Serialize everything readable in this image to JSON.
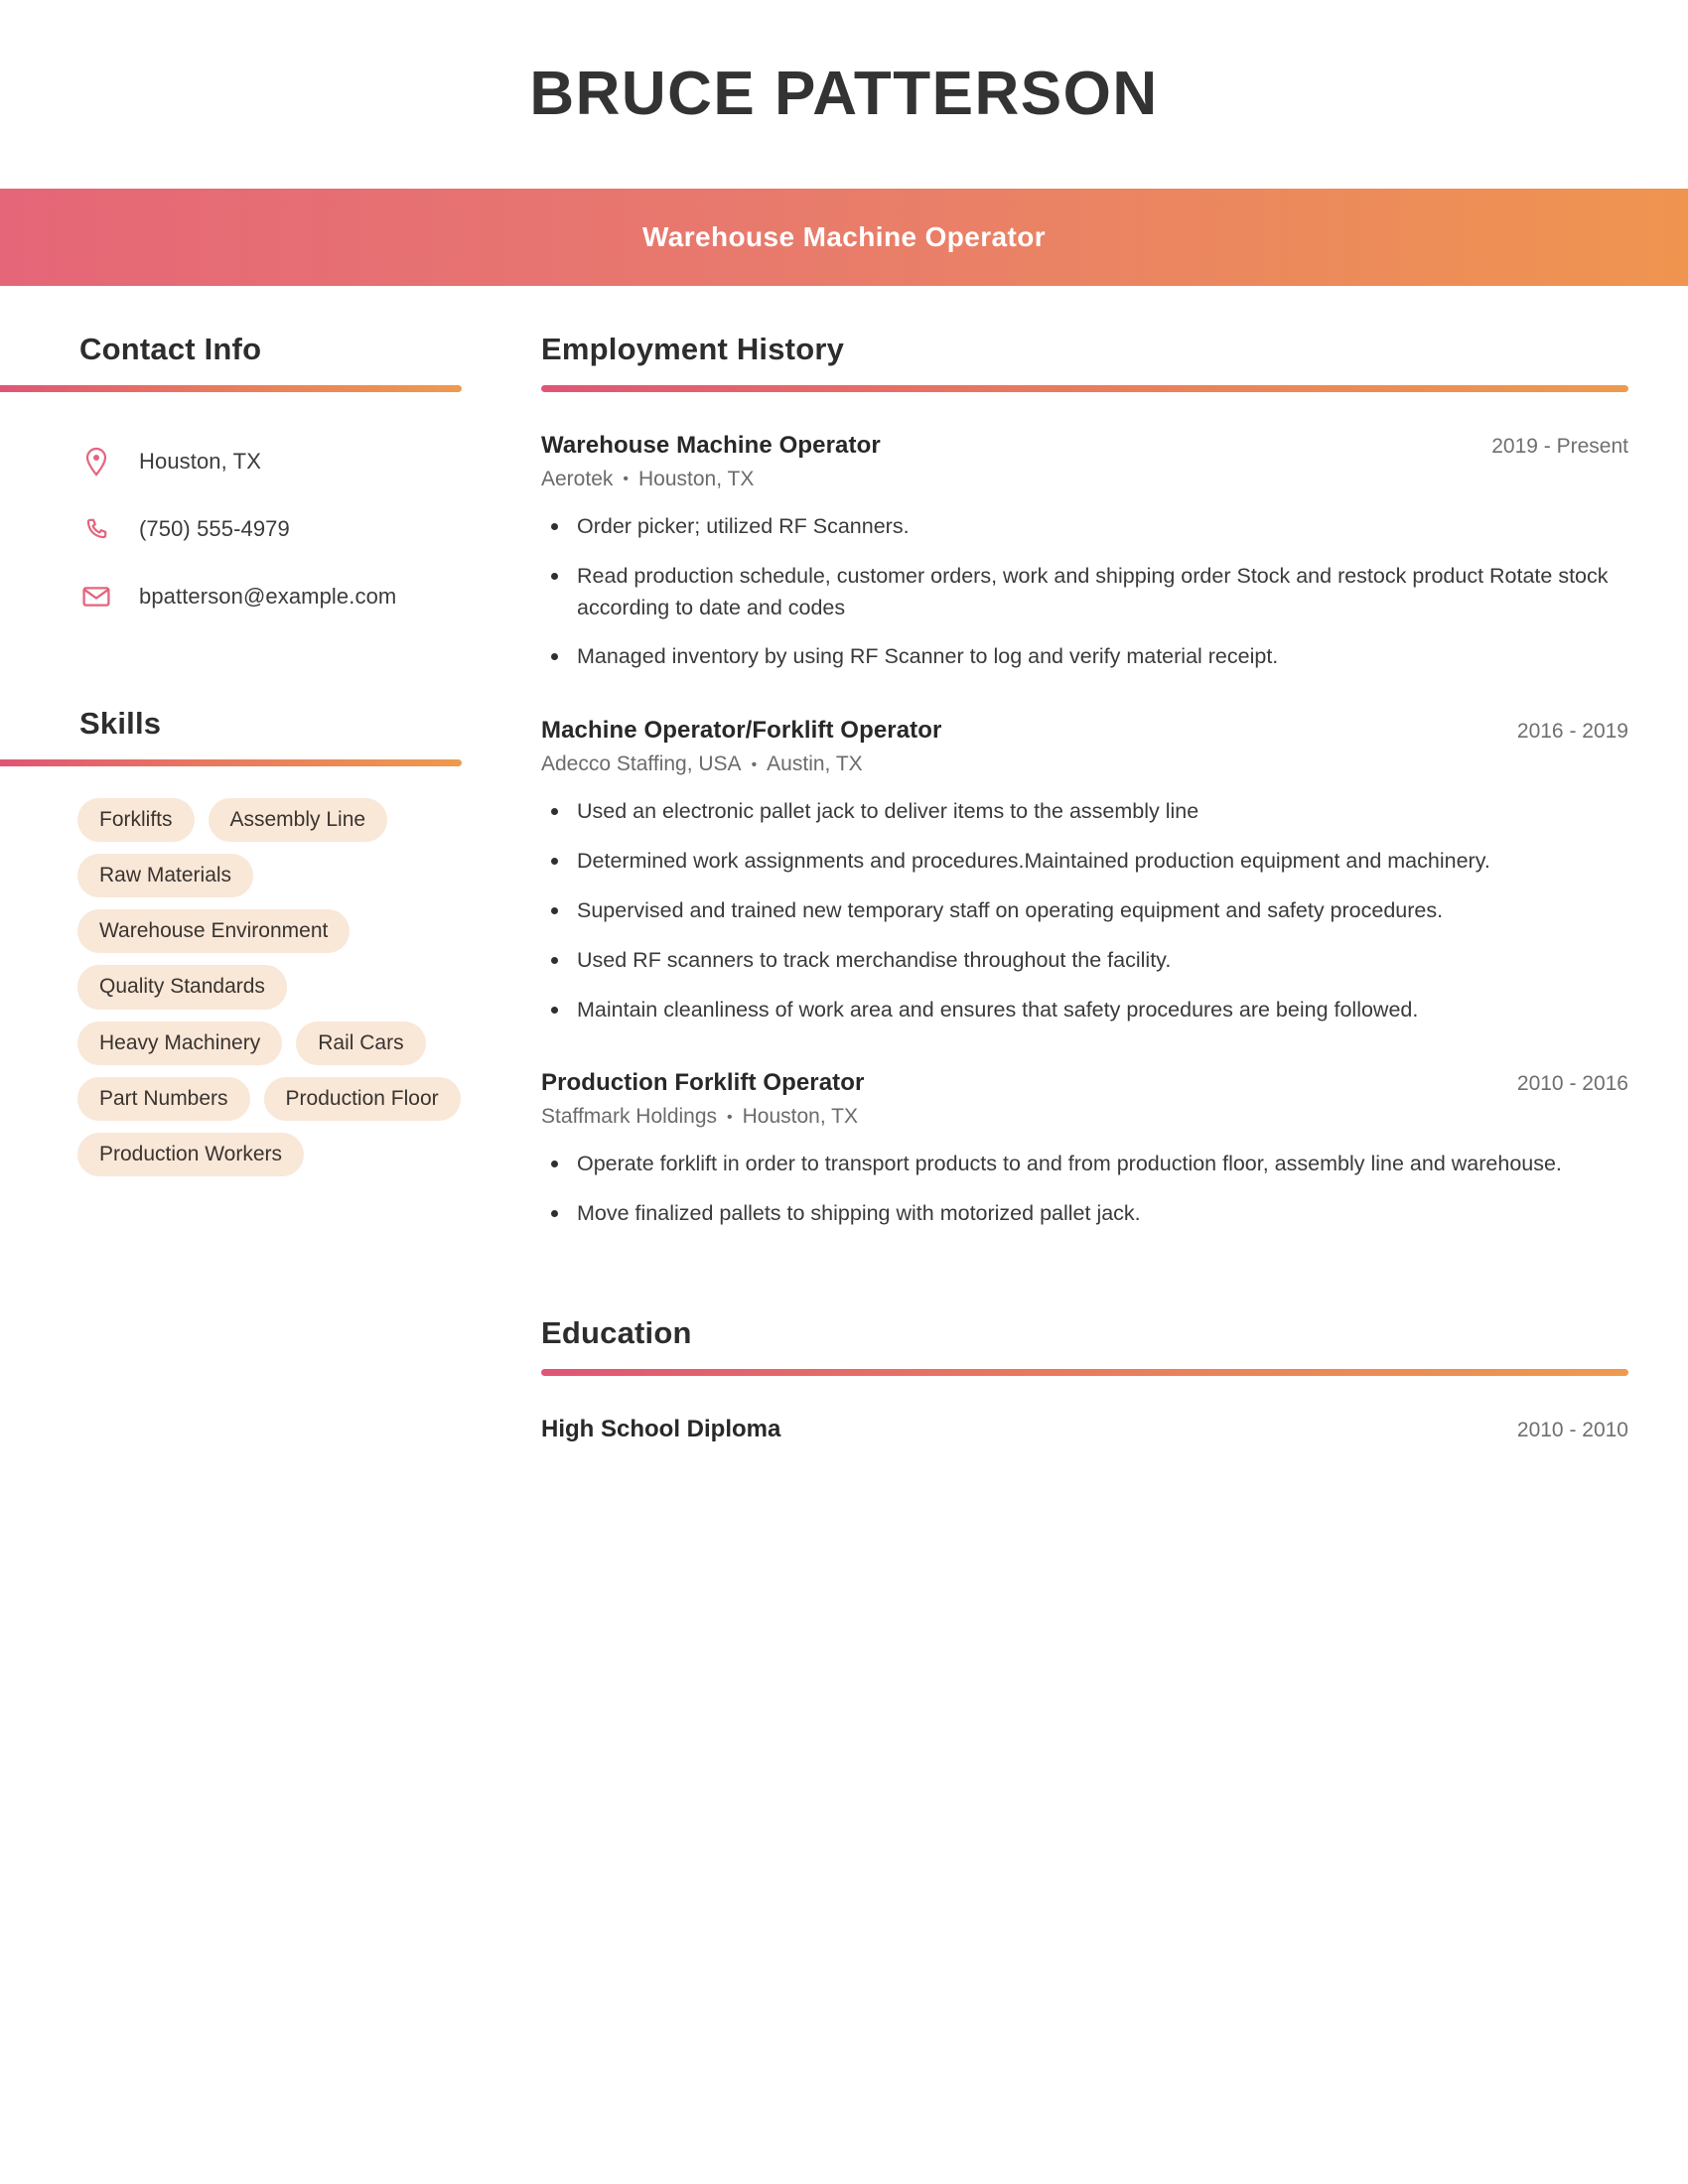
{
  "header": {
    "name": "BRUCE PATTERSON",
    "job_title": "Warehouse Machine Operator"
  },
  "sidebar": {
    "contact": {
      "heading": "Contact Info",
      "items": [
        {
          "icon": "location-pin-icon",
          "value": "Houston, TX"
        },
        {
          "icon": "phone-icon",
          "value": "(750) 555-4979"
        },
        {
          "icon": "envelope-icon",
          "value": "bpatterson@example.com"
        }
      ]
    },
    "skills": {
      "heading": "Skills",
      "items": [
        "Forklifts",
        "Assembly Line",
        "Raw Materials",
        "Warehouse Environment",
        "Quality Standards",
        "Heavy Machinery",
        "Rail Cars",
        "Part Numbers",
        "Production Floor",
        "Production Workers"
      ]
    }
  },
  "main": {
    "employment": {
      "heading": "Employment History",
      "jobs": [
        {
          "title": "Warehouse Machine Operator",
          "dates": "2019 - Present",
          "company": "Aerotek",
          "location": "Houston, TX",
          "bullets": [
            "Order picker; utilized RF Scanners.",
            "Read production schedule, customer orders, work and shipping order Stock and restock product Rotate stock according to date and codes",
            "Managed inventory by using RF Scanner to log and verify material receipt."
          ]
        },
        {
          "title": "Machine Operator/Forklift Operator",
          "dates": "2016 - 2019",
          "company": "Adecco Staffing, USA",
          "location": "Austin, TX",
          "bullets": [
            "Used an electronic pallet jack to deliver items to the assembly line",
            "Determined work assignments and procedures.Maintained production equipment and machinery.",
            "Supervised and trained new temporary staff on operating equipment and safety procedures.",
            "Used RF scanners to track merchandise throughout the facility.",
            "Maintain cleanliness of work area and ensures that safety procedures are being followed."
          ]
        },
        {
          "title": "Production Forklift Operator",
          "dates": "2010 - 2016",
          "company": "Staffmark Holdings",
          "location": "Houston, TX",
          "bullets": [
            "Operate forklift in order to transport products to and from production floor, assembly line and warehouse.",
            "Move finalized pallets to shipping with motorized pallet jack."
          ]
        }
      ]
    },
    "education": {
      "heading": "Education",
      "entries": [
        {
          "degree": "High School Diploma",
          "dates": "2010 - 2010"
        }
      ]
    }
  },
  "theme": {
    "gradient_start": "#e56678",
    "gradient_end": "#ef9550",
    "pill_bg": "#f9e7d8",
    "icon_color": "#e4647c",
    "text_color": "#2e2e2e",
    "muted_text": "#6f6f6f"
  },
  "separator": "•"
}
